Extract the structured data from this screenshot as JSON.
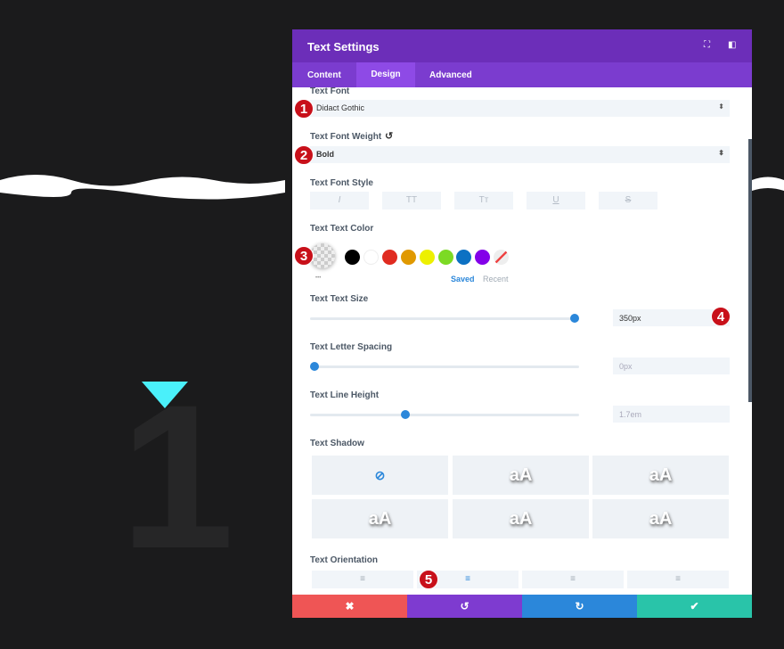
{
  "background": {
    "number": "1"
  },
  "panel": {
    "title": "Text Settings",
    "tabs": [
      "Content",
      "Design",
      "Advanced"
    ],
    "active_tab": "Design"
  },
  "fields": {
    "font": {
      "label": "Text Font",
      "value": "Didact Gothic"
    },
    "weight": {
      "label": "Text Font Weight",
      "value": "Bold"
    },
    "style": {
      "label": "Text Font Style",
      "buttons": [
        "I",
        "TT",
        "Tт",
        "U",
        "S"
      ]
    },
    "color": {
      "label": "Text Text Color",
      "swatches": [
        "#000000",
        "#ffffff",
        "#e02b20",
        "#e09900",
        "#edf000",
        "#7cda24",
        "#0c71c3",
        "#8300e9"
      ],
      "saved": "Saved",
      "recent": "Recent",
      "more": "•••"
    },
    "size": {
      "label": "Text Text Size",
      "value": "350px",
      "fraction": 0.98
    },
    "spacing": {
      "label": "Text Letter Spacing",
      "value": "0px",
      "fraction": 0.0
    },
    "line_height": {
      "label": "Text Line Height",
      "value": "1.7em",
      "fraction": 0.35
    },
    "shadow": {
      "label": "Text Shadow",
      "preview": "aA"
    },
    "orientation": {
      "label": "Text Orientation"
    }
  },
  "badges": [
    "1",
    "2",
    "3",
    "4",
    "5"
  ],
  "colors": {
    "header": "#6c2eb9",
    "tabs": "#7b3ccf",
    "cancel": "#ef5555",
    "undo": "#7e3bd0",
    "redo": "#2b87da",
    "save": "#29c4a9"
  }
}
